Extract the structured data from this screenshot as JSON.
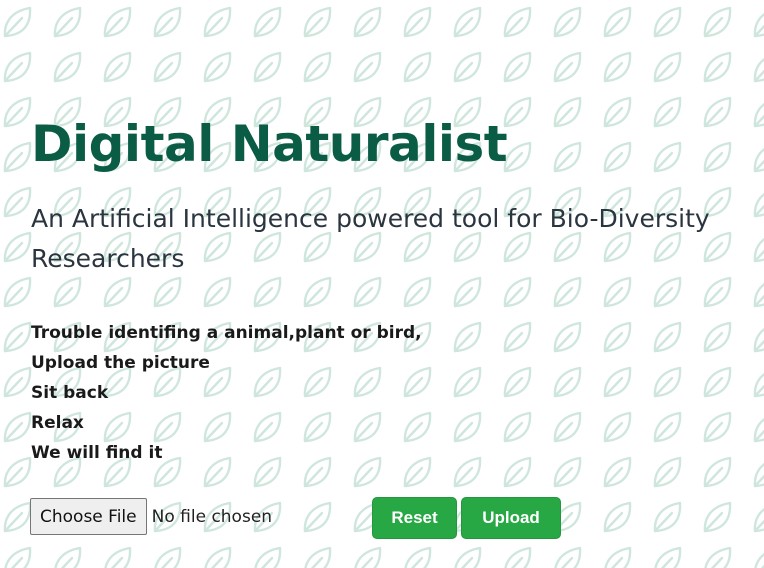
{
  "header": {
    "title": "Digital Naturalist",
    "subtitle": "An Artificial Intelligence powered tool for Bio-Diversity Researchers"
  },
  "intro_lines": [
    "Trouble identifing a animal,plant or bird,",
    "Upload the picture",
    "Sit back",
    "Relax",
    "We will find it"
  ],
  "upload_form": {
    "choose_file_label": "Choose File",
    "file_status": "No file chosen",
    "reset_label": "Reset",
    "upload_label": "Upload"
  },
  "colors": {
    "title": "#0b5c45",
    "button_green": "#28a745",
    "pattern_leaf": "#cfe6dc"
  },
  "icons": {
    "background_pattern": "leaf-icon"
  }
}
